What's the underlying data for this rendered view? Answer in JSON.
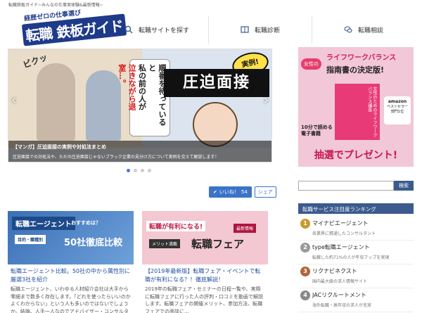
{
  "site": {
    "tagline": "転職鉄板ガイド~みんなの仕事実体験&最新情報~",
    "logo_top": "経歴ゼロの仕事選び",
    "logo_main": "転職 鉄板ガイド"
  },
  "nav": {
    "items": [
      {
        "label": "転職サイトを探す",
        "icon": "search-icon"
      },
      {
        "label": "転職診断",
        "icon": "book-icon"
      },
      {
        "label": "転職相談",
        "icon": "chat-icon"
      }
    ]
  },
  "hero": {
    "sfx": "ビクッ",
    "speech_line1": "順番を待っていると",
    "speech_line2": "私の前の人が",
    "speech_line3": "泣きながら退室…。",
    "speech_emphasis": "泣きながら",
    "badge": "実例!",
    "big_title": "圧迫面接",
    "caption_title": "【マンガ】圧迫面接の実例や対処法まとめ",
    "caption_desc": "圧迫面接での対処法や、ただの圧迫面接じゃないブラック企業の見分け方について実例を交えて解説します！",
    "prev": "‹",
    "next": "›"
  },
  "dots": {
    "count": 4,
    "active": 0
  },
  "share": {
    "like_label": "いいね！",
    "like_count": "54",
    "share_label": "シェア"
  },
  "cards": [
    {
      "thumb": {
        "bar": "転職エージェント",
        "sub": "おすすめは？",
        "tag": "目的・職種別",
        "big": "50社徹底比較"
      },
      "title": "転職エージェント比較。50社の中から属性別に厳選3社を紹介",
      "desc": "転職エージェント、いわゆる人材紹介会社は大手から零細まで数多く存在します。「どれを使ったらいいのかよくわからない」という人も多いのではないでしょうか。結論、人手一人なのでアドバイザー・コンサルタント…"
    },
    {
      "thumb": {
        "pink": "転職が有利になる!",
        "latest": "最新情報",
        "merit": "メリット満載",
        "fair": "転職フェア"
      },
      "title": "【2019年最新版】転職フェア・イベントで転職が有利になる？！徹底解説！",
      "desc": "2019年の転職フェア・セミナーの日程一覧や、実際に転職フェアに行った人の評判・口コミを動画で解説します。転職フェアの開催メリット、参加方法、転職フェアでの面談に…"
    }
  ],
  "ad": {
    "pill": "女性の",
    "line1": "ライフワークバランス",
    "line2": "指南書の決定版!",
    "book_title": "女性のためのライフワークバランス講座",
    "amazon": "amazon",
    "amazon_sub1": "ベストセラー",
    "amazon_sub2": "部門1位",
    "ebook": "10分で読める電子書籍",
    "cta": "抽選でプレゼント!"
  },
  "search": {
    "placeholder": "",
    "button": "検索"
  },
  "ranking": {
    "header": "転職サービス注目度ランキング",
    "items": [
      {
        "rank": "1",
        "name": "マイナビエージェント",
        "sub": "各業界に精通したコンサルタント",
        "color": "#c89a2e"
      },
      {
        "rank": "2",
        "name": "type転職エージェント",
        "sub": "転職した約71%の人が年収アップを実現",
        "color": "#9a9a9a"
      },
      {
        "rank": "3",
        "name": "リクナビネクスト",
        "sub": "国内最大級の求人情報サイト",
        "color": "#b0653a"
      },
      {
        "rank": "4",
        "name": "JACリクルートメント",
        "sub": "海外転職・高年収の求人が充実",
        "color": "#888888"
      }
    ]
  },
  "colors": {
    "accent": "#3b5b8e",
    "link": "#1f4ea0",
    "like": "#3b73c9"
  }
}
